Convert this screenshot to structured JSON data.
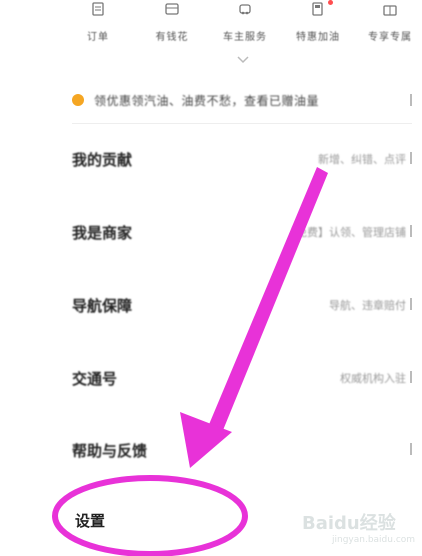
{
  "top_bar": {
    "items": [
      {
        "label": "订单",
        "icon": "order-icon"
      },
      {
        "label": "有钱花",
        "icon": "wallet-icon"
      },
      {
        "label": "车主服务",
        "icon": "car-icon"
      },
      {
        "label": "特惠加油",
        "icon": "fuel-icon"
      },
      {
        "label": "专享专属",
        "icon": "gift-icon"
      }
    ]
  },
  "notice": {
    "text": "领优惠领汽油、油费不愁，查看已赠油量",
    "icon_color": "#f5a623"
  },
  "menu": {
    "items": [
      {
        "title": "我的贡献",
        "desc": "新增、纠错、点评"
      },
      {
        "title": "我是商家",
        "desc": "【免费】认领、管理店铺"
      },
      {
        "title": "导航保障",
        "desc": "导航、违章赔付"
      },
      {
        "title": "交通号",
        "desc": "权威机构入驻"
      },
      {
        "title": "帮助与反馈",
        "desc": ""
      }
    ],
    "settings": "设置"
  },
  "annotation": {
    "color": "#e832d8"
  },
  "watermark": {
    "brand": "Baidu经验",
    "url": "jingyan.baidu.com"
  }
}
